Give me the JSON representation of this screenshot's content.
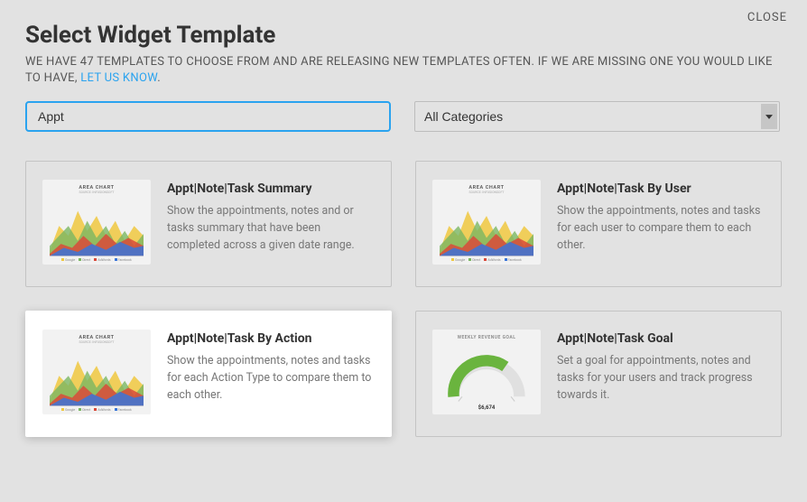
{
  "close_label": "CLOSE",
  "title": "Select Widget Template",
  "subtitle_pre": "WE HAVE 47 TEMPLATES TO CHOOSE FROM AND ARE RELEASING NEW TEMPLATES OFTEN. IF WE ARE MISSING ONE YOU WOULD LIKE TO HAVE, ",
  "subtitle_link": "LET US KNOW",
  "subtitle_suffix": ".",
  "search_value": "Appt",
  "category_selected": "All Categories",
  "thumb_area_label": "AREA CHART",
  "thumb_gauge_label": "WEEKLY REVENUE GOAL",
  "gauge_value": "$6,674",
  "cards": [
    {
      "title": "Appt|Note|Task Summary",
      "desc": "Show the appointments, notes and or tasks summary that have been completed across a given date range."
    },
    {
      "title": "Appt|Note|Task By User",
      "desc": "Show the appointments, notes and tasks for each user to compare them to each other."
    },
    {
      "title": "Appt|Note|Task By Action",
      "desc": "Show the appointments, notes and tasks for each Action Type to compare them to each other."
    },
    {
      "title": "Appt|Note|Task Goal",
      "desc": "Set a goal for appointments, notes and tasks for your users and track progress towards it."
    }
  ]
}
